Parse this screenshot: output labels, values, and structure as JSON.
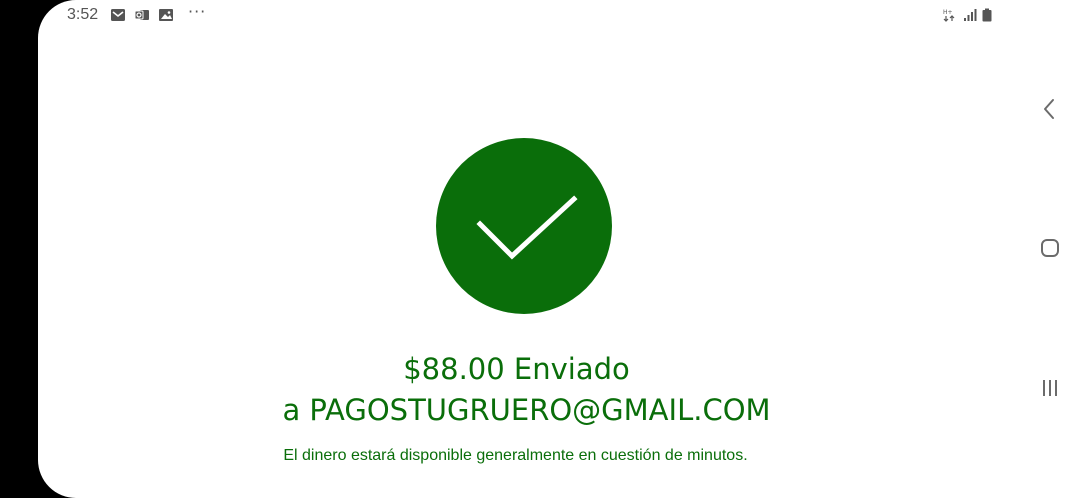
{
  "status_bar": {
    "time": "3:52",
    "icons_left": [
      "mail-icon",
      "outlook-icon",
      "gallery-icon"
    ],
    "more": "···",
    "icons_right": [
      "hd-voice-icon",
      "signal-icon",
      "battery-icon"
    ]
  },
  "colors": {
    "brand_green": "#0a6e0a",
    "check_white": "#ffffff",
    "status_gray": "#555555",
    "nav_gray": "#6b6b6b"
  },
  "confirmation": {
    "icon": "checkmark-icon",
    "amount_line": "$88.00 Enviado",
    "recipient_line": "a PAGOSTUGRUERO@GMAIL.COM",
    "info_line": "El dinero estará disponible generalmente en cuestión de minutos."
  },
  "nav_bar": {
    "buttons": [
      "back-icon",
      "home-icon",
      "recents-icon"
    ]
  }
}
